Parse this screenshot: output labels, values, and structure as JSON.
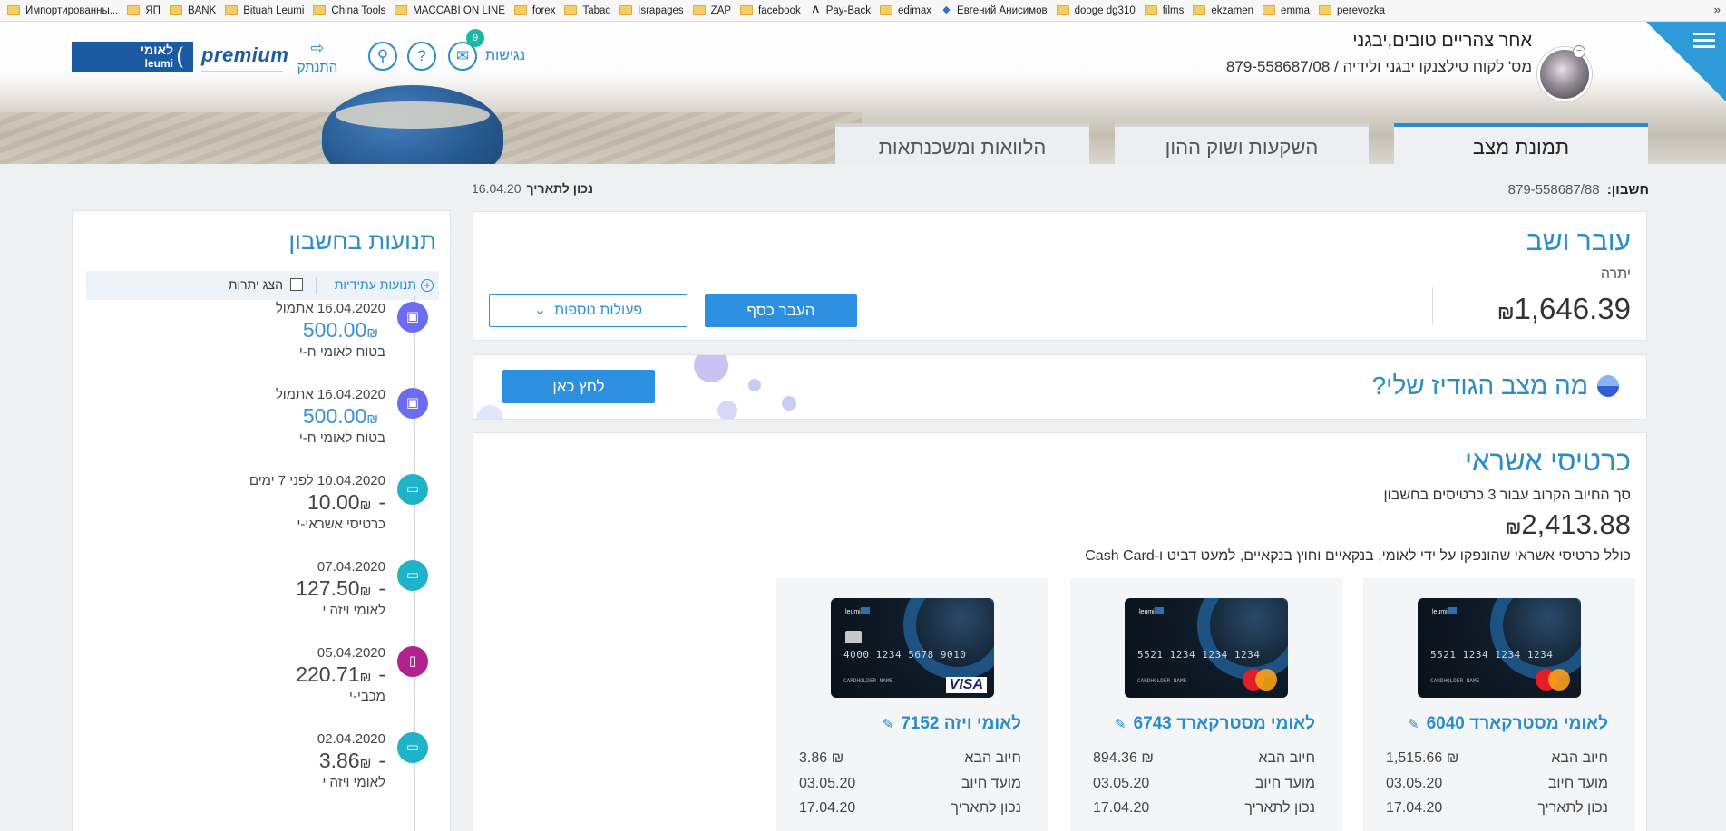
{
  "bookmarks": {
    "items": [
      "Импортированны...",
      "ЯП",
      "BANK",
      "Bituah Leumi",
      "China Tools",
      "MACCABI ON LINE",
      "forex",
      "Tabac",
      "Israpages",
      "ZAP",
      "facebook",
      "Pay-Back",
      "edimax",
      "Евгений Анисимов",
      "dooge dg310",
      "films",
      "ekzamen",
      "emma",
      "perevozka"
    ],
    "more": "»"
  },
  "header": {
    "logo_heb": "לאומי",
    "logo_lat": "leumi",
    "premium": "premium",
    "logout_label": "התנתק",
    "logout_icon": "logout-icon",
    "notifications_count": "9",
    "accessibility_label": "נגישות",
    "greeting": "אחר צהריים טובים,יבגני",
    "customer_line": "מס' לקוח  טילצנקו יבגני ולידיה / 879-558687/08",
    "avatar_min": "−",
    "accent_color": "#2a8cc9"
  },
  "tabs": [
    "תמונת מצב",
    "השקעות ושוק ההון",
    "הלוואות ומשכנתאות"
  ],
  "date_bar": {
    "label": "נכון לתאריך",
    "value": "16.04.20"
  },
  "account": {
    "label": "חשבון:",
    "value": "879-558687/88"
  },
  "transactions": {
    "title": "תנועות בחשבון",
    "future_label": "תנועות עתידיות",
    "show_balances_label": "הצג יתרות",
    "items": [
      {
        "line1": "16.04.2020 אתמול",
        "amount": "500.00",
        "desc": "בטוח לאומי ח-י",
        "icon": "wallet-icon",
        "color": "#6c6cf0",
        "positive": true
      },
      {
        "line1": "16.04.2020 אתמול",
        "amount": "500.00",
        "desc": "בטוח לאומי ח-י",
        "icon": "wallet-icon",
        "color": "#6c6cf0",
        "positive": true
      },
      {
        "line1": "10.04.2020 לפני 7 ימים",
        "amount": "-10.00",
        "desc": "כרטיסי אשראי-י",
        "icon": "credit-card-icon",
        "color": "#1fb3c9",
        "positive": false
      },
      {
        "line1": "07.04.2020",
        "amount": "-127.50",
        "desc": "לאומי ויזה י",
        "icon": "credit-card-icon",
        "color": "#1fb3c9",
        "positive": false
      },
      {
        "line1": "05.04.2020",
        "amount": "-220.71",
        "desc": "מכבי-י",
        "icon": "receipt-icon",
        "color": "#b0238c",
        "positive": false
      },
      {
        "line1": "02.04.2020",
        "amount": "-3.86",
        "desc": "לאומי ויזה י",
        "icon": "credit-card-icon",
        "color": "#1fb3c9",
        "positive": false
      }
    ],
    "currency": "₪"
  },
  "balance": {
    "title": "עובר ושב",
    "label": "יתרה",
    "amount": "1,646.39",
    "currency": "₪",
    "transfer_btn": "העבר כסף",
    "more_actions_btn": "פעולות נוספות"
  },
  "gadget": {
    "title": "מה מצב הגודיז שלי?",
    "button": "לחץ כאן"
  },
  "credit_cards": {
    "title": "כרטיסי אשראי",
    "subtitle": "סך החיוב הקרוב עבור 3 כרטיסים בחשבון",
    "total": "2,413.88",
    "currency": "₪",
    "note": "כולל כרטיסי אשראי שהונפקו על ידי לאומי, בנקאיים וחוץ בנקאיים, למעט דביט ו-Cash Card",
    "row_labels": {
      "next_charge": "חיוב הבא",
      "charge_date": "מועד חיוב",
      "as_of": "נכון לתאריך"
    },
    "cards": [
      {
        "name": "לאומי מסטרקארד 6040",
        "next_charge": "₪ 1,515.66",
        "charge_date": "03.05.20",
        "as_of": "17.04.20",
        "brand": "mastercard",
        "number": "5521 1234 1234 1234",
        "holder": "CARDHOLDER NAME",
        "logo": "leumi"
      },
      {
        "name": "לאומי מסטרקארד 6743",
        "next_charge": "₪ 894.36",
        "charge_date": "03.05.20",
        "as_of": "17.04.20",
        "brand": "mastercard",
        "number": "5521 1234 1234 1234",
        "holder": "CARDHOLDER NAME",
        "logo": "leumi"
      },
      {
        "name": "לאומי ויזה 7152",
        "next_charge": "₪ 3.86",
        "charge_date": "03.05.20",
        "as_of": "17.04.20",
        "brand": "visa",
        "number": "4000 1234 5678 9010",
        "holder": "CARDHOLDER NAME",
        "logo": "leumi",
        "brand_text": "VISA"
      }
    ]
  }
}
